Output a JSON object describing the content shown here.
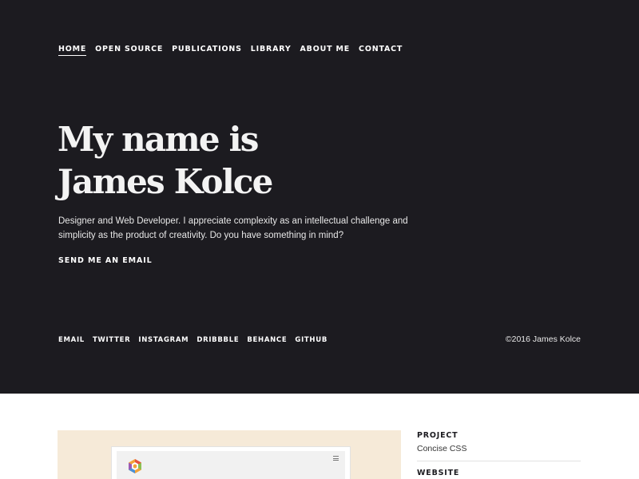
{
  "nav": {
    "items": [
      "HOME",
      "OPEN SOURCE",
      "PUBLICATIONS",
      "LIBRARY",
      "ABOUT ME",
      "CONTACT"
    ],
    "active": "HOME"
  },
  "hero": {
    "headline_line1": "My name is",
    "headline_line2": "James Kolce",
    "intro": "Designer and Web Developer. I appreciate complexity as an intellectual challenge and simplicity as the product of creativity. Do you have something in mind?",
    "cta": "SEND ME AN EMAIL"
  },
  "social": {
    "items": [
      "EMAIL",
      "TWITTER",
      "INSTAGRAM",
      "DRIBBBLE",
      "BEHANCE",
      "GITHUB"
    ]
  },
  "footer": {
    "copyright": "©2016 James Kolce"
  },
  "project": {
    "label": "PROJECT",
    "value": "Concise CSS",
    "website_label": "WEBSITE",
    "logo_icon": "hexagon-logo-icon",
    "menu_icon": "hamburger-menu-icon"
  },
  "colors": {
    "hero_background": "#1c1b20",
    "thumb_background": "#f6ead8"
  }
}
